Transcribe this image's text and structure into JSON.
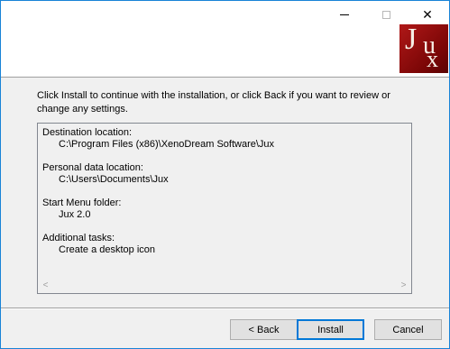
{
  "titlebar": {
    "minimize_icon": "minimize-icon",
    "maximize_icon": "maximize-icon",
    "close_glyph": "✕"
  },
  "header": {
    "logo_letters": [
      "J",
      "u",
      "x"
    ]
  },
  "intro_text": "Click Install to continue with the installation, or click Back if you want to review or change any settings.",
  "summary": {
    "items": [
      {
        "label": "Destination location:",
        "value": "C:\\Program Files (x86)\\XenoDream Software\\Jux"
      },
      {
        "label": "Personal data location:",
        "value": "C:\\Users\\Documents\\Jux"
      },
      {
        "label": "Start Menu folder:",
        "value": "Jux 2.0"
      },
      {
        "label": "Additional tasks:",
        "value": "Create a desktop icon"
      }
    ],
    "scroll_left_glyph": "<",
    "scroll_right_glyph": ">"
  },
  "buttons": {
    "back": "< Back",
    "install": "Install",
    "cancel": "Cancel"
  }
}
